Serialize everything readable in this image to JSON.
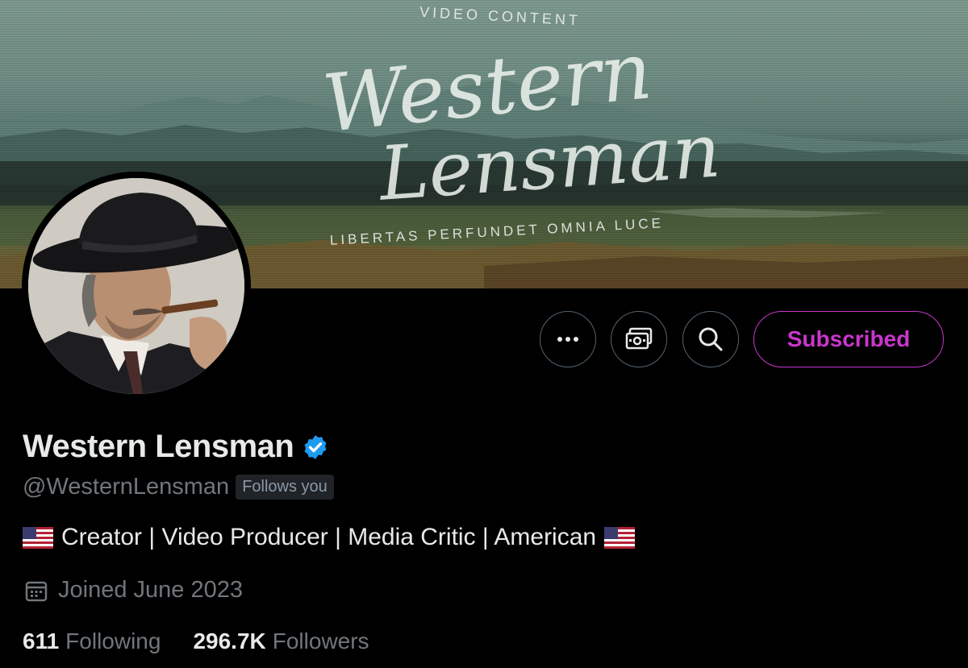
{
  "banner": {
    "top_text": "VIDEO CONTENT",
    "script_line1": "Western",
    "script_line2": "Lensman",
    "bottom_text": "LIBERTAS PERFUNDET OMNIA LUCE"
  },
  "profile": {
    "display_name": "Western Lensman",
    "handle": "@WesternLensman",
    "follows_you": "Follows you",
    "bio": "Creator | Video Producer | Media Critic | American",
    "joined": "Joined June 2023",
    "following_count": "611",
    "following_label": "Following",
    "followers_count": "296.7K",
    "followers_label": "Followers"
  },
  "actions": {
    "more_icon": "more-icon",
    "tip_icon": "tip-money-icon",
    "search_icon": "search-icon",
    "subscribed_label": "Subscribed"
  },
  "colors": {
    "background": "#000000",
    "text_primary": "#e7e9ea",
    "text_secondary": "#71767b",
    "subscribed_accent": "#c936cc",
    "verified_blue": "#1d9bf0"
  }
}
